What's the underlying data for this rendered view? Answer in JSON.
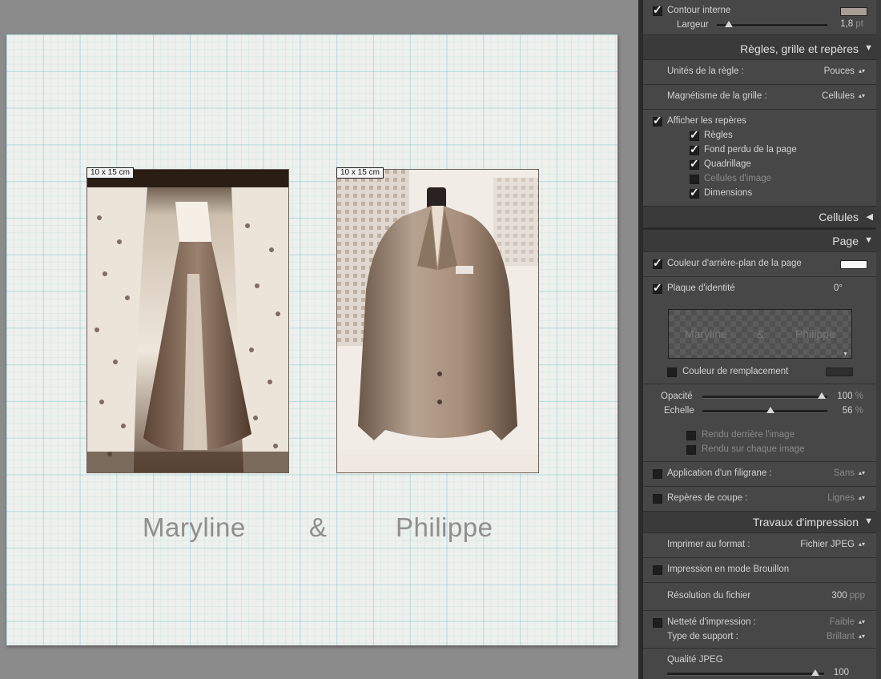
{
  "canvas": {
    "cells": [
      {
        "dimension_label": "10 x 15 cm",
        "subject": "wedding-dress-photo"
      },
      {
        "dimension_label": "10 x 15 cm",
        "subject": "suit-jacket-photo"
      }
    ],
    "identity_plate": {
      "left": "Maryline",
      "mid": "&",
      "right": "Philippe"
    }
  },
  "panel": {
    "inner_stroke": {
      "label": "Contour interne",
      "color": "#a89e93",
      "width_label": "Largeur",
      "width_value": "1,8",
      "width_unit": "pt",
      "width_fraction": 0.05
    },
    "rulers_section": {
      "title": "Règles, grille et repères",
      "ruler_units_label": "Unités de la règle :",
      "ruler_units_value": "Pouces",
      "grid_snap_label": "Magnétisme de la grille :",
      "grid_snap_value": "Cellules",
      "show_guides_label": "Afficher les repères",
      "guides": [
        {
          "label": "Règles",
          "checked": true
        },
        {
          "label": "Fond perdu de la page",
          "checked": true
        },
        {
          "label": "Quadrillage",
          "checked": true
        },
        {
          "label": "Cellules d'image",
          "checked": false
        },
        {
          "label": "Dimensions",
          "checked": true
        }
      ]
    },
    "cells_section": {
      "title": "Cellules"
    },
    "page_section": {
      "title": "Page",
      "bg_color_label": "Couleur d'arrière-plan de la page",
      "bg_color": "#f7f7f7",
      "identity_label": "Plaque d'identité",
      "identity_angle": "0°",
      "identity_preview": {
        "left": "Maryline",
        "mid": "&",
        "right": "Philippe"
      },
      "override_color_label": "Couleur de remplacement",
      "override_color": "#2e2e2e",
      "opacity_label": "Opacité",
      "opacity_value": "100",
      "opacity_fraction": 1.0,
      "scale_label": "Echelle",
      "scale_value": "56",
      "scale_fraction": 0.56,
      "percent": "%",
      "render_behind_label": "Rendu derrière l'image",
      "render_each_label": "Rendu sur chaque image",
      "watermark_label": "Application d'un filigrane :",
      "watermark_value": "Sans",
      "crop_marks_label": "Repères de coupe :",
      "crop_marks_value": "Lignes"
    },
    "print_job_section": {
      "title": "Travaux d'impression",
      "print_to_label": "Imprimer au format :",
      "print_to_value": "Fichier JPEG",
      "draft_label": "Impression en mode Brouillon",
      "resolution_label": "Résolution du fichier",
      "resolution_value": "300",
      "resolution_unit": "ppp",
      "sharpening_label": "Netteté d'impression :",
      "sharpening_value": "Faible",
      "media_type_label": "Type de support :",
      "media_type_value": "Brillant",
      "jpeg_quality_label": "Qualité JPEG",
      "jpeg_quality_value": "100",
      "jpeg_quality_fraction": 0.96
    }
  }
}
